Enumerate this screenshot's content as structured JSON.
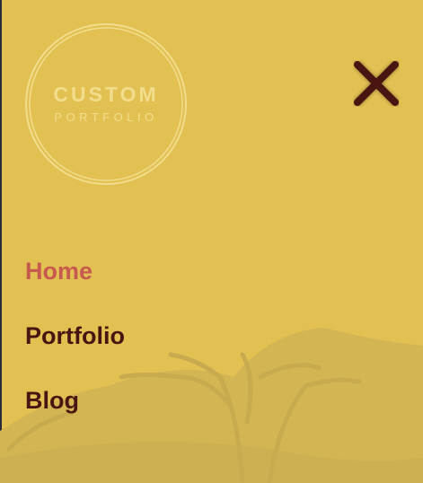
{
  "logo": {
    "line1": "CUSTOM",
    "line2": "PORTFOLIO"
  },
  "nav": {
    "items": [
      {
        "label": "Home",
        "active": true
      },
      {
        "label": "Portfolio"
      },
      {
        "label": "Blog"
      }
    ]
  },
  "colors": {
    "background": "#e2c052",
    "active": "#c65a4e",
    "text": "#4a1410",
    "logo": "#f1dd8c"
  }
}
